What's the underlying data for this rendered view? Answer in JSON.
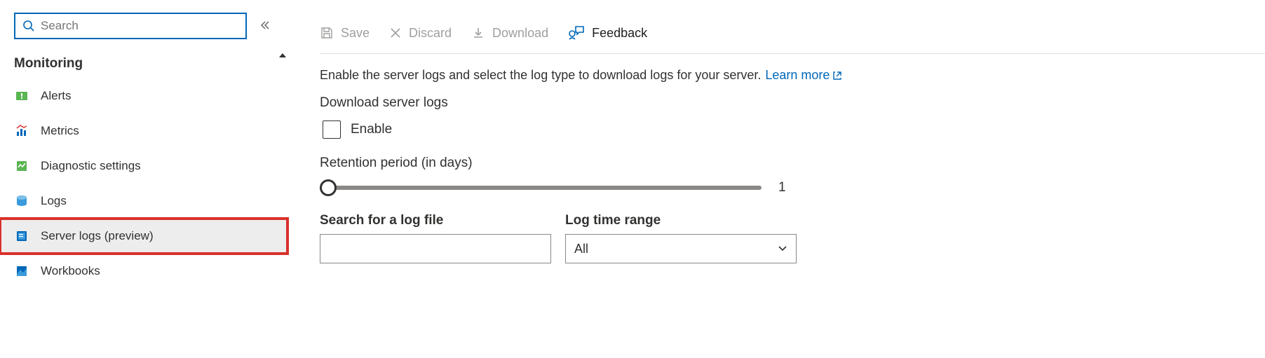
{
  "sidebar": {
    "search_placeholder": "Search",
    "section": "Monitoring",
    "items": [
      {
        "label": "Alerts"
      },
      {
        "label": "Metrics"
      },
      {
        "label": "Diagnostic settings"
      },
      {
        "label": "Logs"
      },
      {
        "label": "Server logs (preview)"
      },
      {
        "label": "Workbooks"
      }
    ]
  },
  "toolbar": {
    "save": "Save",
    "discard": "Discard",
    "download": "Download",
    "feedback": "Feedback"
  },
  "main": {
    "description": "Enable the server logs and select the log type to download logs for your server.",
    "learn_more": "Learn more",
    "download_label": "Download server logs",
    "enable_label": "Enable",
    "retention_label": "Retention period (in days)",
    "retention_value": "1",
    "search_label": "Search for a log file",
    "range_label": "Log time range",
    "range_value": "All"
  }
}
